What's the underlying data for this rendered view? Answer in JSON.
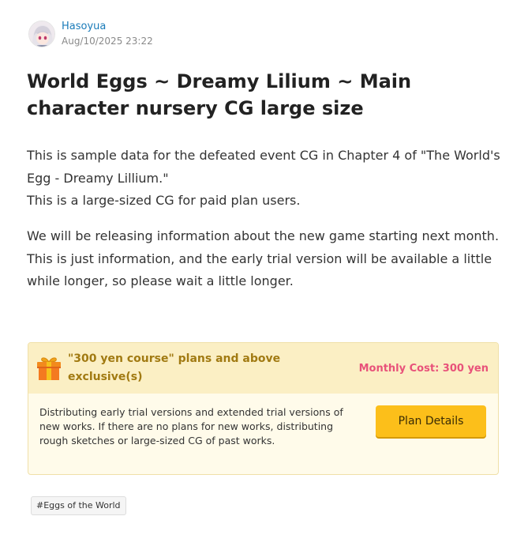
{
  "author": {
    "name": "Hasoyua",
    "date": "Aug/10/2025 23:22"
  },
  "post": {
    "title": "World Eggs ~ Dreamy Lilium ~ Main character nursery CG large size",
    "paragraph1_line1": "This is sample data for the defeated event CG in Chapter 4 of \"The World's Egg - Dreamy Lillium.\"",
    "paragraph1_line2": "This is a large-sized CG for paid plan users.",
    "paragraph2_line1": "We will be releasing information about the new game starting next month.",
    "paragraph2_line2": "This is just information, and the early trial version will be available a little while longer, so please wait a little longer."
  },
  "plan": {
    "title": "\"300 yen course\" plans and above exclusive(s)",
    "cost": "Monthly Cost: 300 yen",
    "description": "Distributing early trial versions and extended trial versions of new works. If there are no plans for new works, distributing rough sketches or large-sized CG of past works.",
    "button_label": "Plan Details",
    "icon": "gift-icon",
    "colors": {
      "header_bg": "#fbefc4",
      "body_bg": "#fffbea",
      "title": "#a17a12",
      "cost": "#e8527a",
      "button": "#fcbf1a"
    }
  },
  "tags": [
    "#Eggs of the World"
  ]
}
